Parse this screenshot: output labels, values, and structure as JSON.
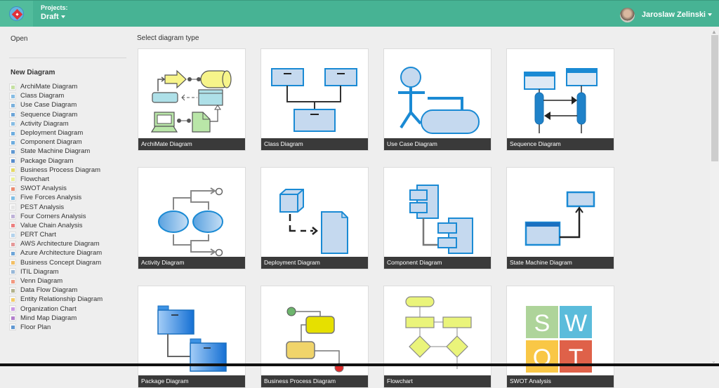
{
  "header": {
    "projects_label": "Projects:",
    "project_name": "Draft",
    "user_name": "Jaroslaw Zelinski"
  },
  "sidebar": {
    "open_label": "Open",
    "new_diagram_title": "New Diagram",
    "items": [
      {
        "label": "ArchiMate Diagram",
        "icon": "archimate-icon",
        "color": "#b8d98a"
      },
      {
        "label": "Class Diagram",
        "icon": "class-diagram-icon",
        "color": "#6aaede"
      },
      {
        "label": "Use Case Diagram",
        "icon": "use-case-icon",
        "color": "#5a9fd6"
      },
      {
        "label": "Sequence Diagram",
        "icon": "sequence-icon",
        "color": "#4a90d0"
      },
      {
        "label": "Activity Diagram",
        "icon": "activity-icon",
        "color": "#6aaede"
      },
      {
        "label": "Deployment Diagram",
        "icon": "deployment-icon",
        "color": "#4a9ad8"
      },
      {
        "label": "Component Diagram",
        "icon": "component-icon",
        "color": "#4a9ad8"
      },
      {
        "label": "State Machine Diagram",
        "icon": "state-machine-icon",
        "color": "#3a80c8"
      },
      {
        "label": "Package Diagram",
        "icon": "package-icon",
        "color": "#2f70c0"
      },
      {
        "label": "Business Process Diagram",
        "icon": "business-process-icon",
        "color": "#e0d040"
      },
      {
        "label": "Flowchart",
        "icon": "flowchart-icon",
        "color": "#e6ec80"
      },
      {
        "label": "SWOT Analysis",
        "icon": "swot-icon",
        "color": "#e87050"
      },
      {
        "label": "Five Forces Analysis",
        "icon": "five-forces-icon",
        "color": "#60b0e0"
      },
      {
        "label": "PEST Analysis",
        "icon": "pest-icon",
        "color": "#e0e0e0"
      },
      {
        "label": "Four Corners Analysis",
        "icon": "four-corners-icon",
        "color": "#b0a0d0"
      },
      {
        "label": "Value Chain Analysis",
        "icon": "value-chain-icon",
        "color": "#e86060"
      },
      {
        "label": "PERT Chart",
        "icon": "pert-chart-icon",
        "color": "#a0c8e8"
      },
      {
        "label": "AWS Architecture Diagram",
        "icon": "aws-icon",
        "color": "#e08080"
      },
      {
        "label": "Azure Architecture Diagram",
        "icon": "azure-icon",
        "color": "#4a90d0"
      },
      {
        "label": "Business Concept Diagram",
        "icon": "business-concept-icon",
        "color": "#f0b040"
      },
      {
        "label": "ITIL Diagram",
        "icon": "itil-icon",
        "color": "#80a8d0"
      },
      {
        "label": "Venn Diagram",
        "icon": "venn-icon",
        "color": "#f08060"
      },
      {
        "label": "Data Flow Diagram",
        "icon": "data-flow-icon",
        "color": "#a0a070"
      },
      {
        "label": "Entity Relationship Diagram",
        "icon": "entity-relationship-icon",
        "color": "#f0c040"
      },
      {
        "label": "Organization Chart",
        "icon": "org-chart-icon",
        "color": "#c080e0"
      },
      {
        "label": "Mind Map Diagram",
        "icon": "mind-map-icon",
        "color": "#a060c0"
      },
      {
        "label": "Floor Plan",
        "icon": "floor-plan-icon",
        "color": "#3a80c8"
      }
    ]
  },
  "main": {
    "title": "Select diagram type",
    "cards": [
      {
        "label": "ArchiMate Diagram",
        "art": "archimate"
      },
      {
        "label": "Class Diagram",
        "art": "class"
      },
      {
        "label": "Use Case Diagram",
        "art": "usecase"
      },
      {
        "label": "Sequence Diagram",
        "art": "sequence"
      },
      {
        "label": "Activity Diagram",
        "art": "activity"
      },
      {
        "label": "Deployment Diagram",
        "art": "deployment"
      },
      {
        "label": "Component Diagram",
        "art": "component"
      },
      {
        "label": "State Machine Diagram",
        "art": "statemachine"
      },
      {
        "label": "Package Diagram",
        "art": "package"
      },
      {
        "label": "Business Process Diagram",
        "art": "bpd"
      },
      {
        "label": "Flowchart",
        "art": "flowchart"
      },
      {
        "label": "SWOT Analysis",
        "art": "swot"
      }
    ],
    "swot_letters": [
      "S",
      "W",
      "O",
      "T"
    ],
    "swot_colors": [
      "#aed49a",
      "#5bbcdb",
      "#f9c746",
      "#df6149"
    ]
  }
}
